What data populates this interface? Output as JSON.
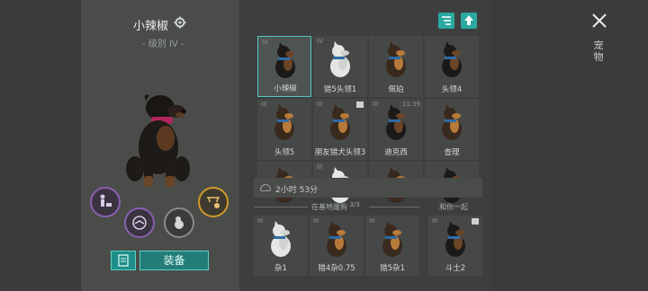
{
  "dog": {
    "name": "小辣椒",
    "level": "- 级别 IV -"
  },
  "buttons": {
    "equip": "装备"
  },
  "side": {
    "text": "宠物"
  },
  "timer": {
    "text": "2小时 53分"
  },
  "section": {
    "at_base": "在基地遛狗",
    "at_base_count": "3/3",
    "with_you": "和你一起"
  },
  "grid": [
    {
      "level": "IV",
      "label": "小辣椒",
      "coat": "rott",
      "selected": true
    },
    {
      "level": "IV",
      "label": "猎5头领1",
      "coat": "white"
    },
    {
      "level": "",
      "label": "佩珀",
      "coat": "shep"
    },
    {
      "level": "",
      "label": "头领4",
      "coat": "rott"
    },
    {
      "level": "III",
      "label": "头领5",
      "coat": "shep"
    },
    {
      "level": "III",
      "label": "朋友猎犬头领3",
      "coat": "shep",
      "badge": true
    },
    {
      "level": "III",
      "label": "迪克西",
      "coat": "rott",
      "time": "11:39"
    },
    {
      "level": "",
      "label": "查理",
      "coat": "shep"
    },
    {
      "level": "",
      "label": "",
      "coat": "shep"
    },
    {
      "level": "III",
      "label": "",
      "coat": "white"
    },
    {
      "level": "",
      "label": "",
      "coat": "shep"
    },
    {
      "level": "",
      "label": "",
      "coat": "rott"
    }
  ],
  "bottom": [
    {
      "level": "III",
      "label": "杂1",
      "coat": "white"
    },
    {
      "level": "III",
      "label": "猎4杂0.75",
      "coat": "shep"
    },
    {
      "level": "III",
      "label": "猎5杂1",
      "coat": "shep"
    },
    {
      "level": "III",
      "label": "斗士2",
      "coat": "rott",
      "badge": true
    }
  ],
  "colors": {
    "accent": "#2aa9a0",
    "purple": "#8a5fb0",
    "gold": "#d09a2a"
  }
}
